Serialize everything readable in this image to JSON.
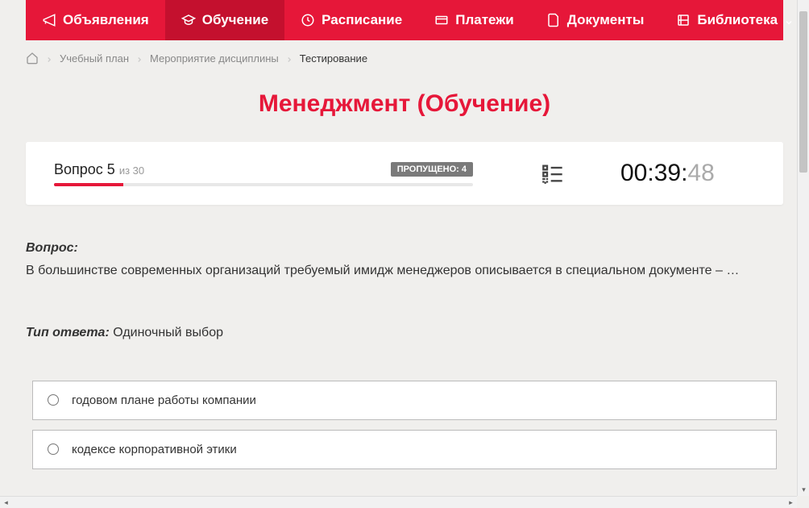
{
  "nav": {
    "items": [
      {
        "label": "Объявления",
        "icon": "megaphone-icon"
      },
      {
        "label": "Обучение",
        "icon": "graduation-icon",
        "active": true
      },
      {
        "label": "Расписание",
        "icon": "clock-icon"
      },
      {
        "label": "Платежи",
        "icon": "payment-icon"
      },
      {
        "label": "Документы",
        "icon": "document-icon"
      },
      {
        "label": "Библиотека",
        "icon": "library-icon",
        "dropdown": true
      }
    ]
  },
  "breadcrumbs": {
    "items": [
      {
        "label": "Учебный план"
      },
      {
        "label": "Мероприятие дисциплины"
      }
    ],
    "current": "Тестирование"
  },
  "page_title": "Менеджмент (Обучение)",
  "status": {
    "question_label": "Вопрос 5",
    "total_label": "из 30",
    "skipped_label": "ПРОПУЩЕНО: 4",
    "progress_percent": 16.6
  },
  "timer": {
    "main": "00:39:",
    "seconds": "48"
  },
  "question": {
    "label": "Вопрос:",
    "text": "В большинстве современных организаций требуемый имидж менеджеров описывается в специальном документе – …",
    "answer_type_label": "Тип ответа:",
    "answer_type_value": " Одиночный выбор"
  },
  "answers": [
    {
      "text": "годовом плане работы компании"
    },
    {
      "text": "кодексе корпоративной этики"
    }
  ]
}
